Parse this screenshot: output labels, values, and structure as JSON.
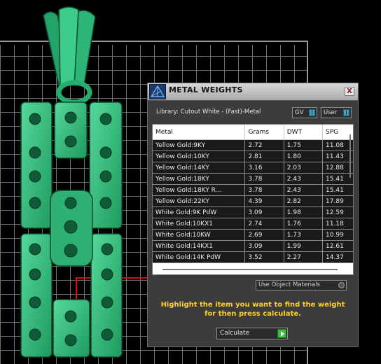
{
  "dialog": {
    "title": "METAL WEIGHTS",
    "close_label": "X",
    "library_label": "Library: Cutout White - (Fast)-Metal",
    "gv_label": "GV",
    "user_label": "User",
    "columns": [
      "Metal",
      "Grams",
      "DWT",
      "SPG"
    ],
    "rows": [
      [
        "Yellow Gold:9KY",
        "2.72",
        "1.75",
        "11.08"
      ],
      [
        "Yellow Gold:10KY",
        "2.81",
        "1.80",
        "11.43"
      ],
      [
        "Yellow Gold:14KY",
        "3.16",
        "2.03",
        "12.88"
      ],
      [
        "Yellow Gold:18KY",
        "3.78",
        "2.43",
        "15.41"
      ],
      [
        "Yellow Gold:18KY R...",
        "3.78",
        "2.43",
        "15.41"
      ],
      [
        "Yellow Gold:22KY",
        "4.39",
        "2.82",
        "17.89"
      ],
      [
        "White Gold:9K PdW",
        "3.09",
        "1.98",
        "12.59"
      ],
      [
        "White Gold:10KX1",
        "2.74",
        "1.76",
        "11.18"
      ],
      [
        "White Gold:10KW",
        "2.69",
        "1.73",
        "10.99"
      ],
      [
        "White Gold:14KX1",
        "3.09",
        "1.99",
        "12.61"
      ],
      [
        "White Gold:14K PdW",
        "3.52",
        "2.27",
        "14.37"
      ]
    ],
    "use_object_materials_label": "Use Object Materials",
    "instructions": "Highlight the item you want to find the weight for then press calculate.",
    "calculate_label": "Calculate"
  },
  "colors": {
    "model": "#2fb878",
    "model_dark": "#0f5a38",
    "instruction_text": "#ffd21a",
    "grid_line": "#6f6f6f",
    "axis": "#d01010"
  }
}
